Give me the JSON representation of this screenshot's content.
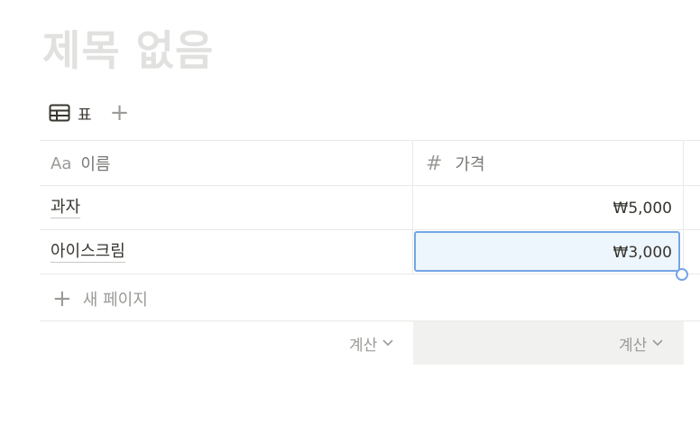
{
  "page": {
    "title": "제목 없음"
  },
  "view": {
    "tab_label": "표",
    "add_symbol": "+"
  },
  "columns": [
    {
      "type_icon": "Aa",
      "label": "이름"
    },
    {
      "type_icon": "#",
      "label": "가격"
    }
  ],
  "rows": [
    {
      "name": "과자",
      "price": "₩5,000"
    },
    {
      "name": "아이스크림",
      "price": "₩3,000"
    }
  ],
  "new_page": {
    "plus": "+",
    "label": "새 페이지"
  },
  "footer": {
    "calc_name": "계산",
    "calc_price": "계산"
  },
  "colors": {
    "selection_border": "#74a6e4",
    "selection_fill": "#edf5fd",
    "title_placeholder": "#e1e1e0"
  }
}
